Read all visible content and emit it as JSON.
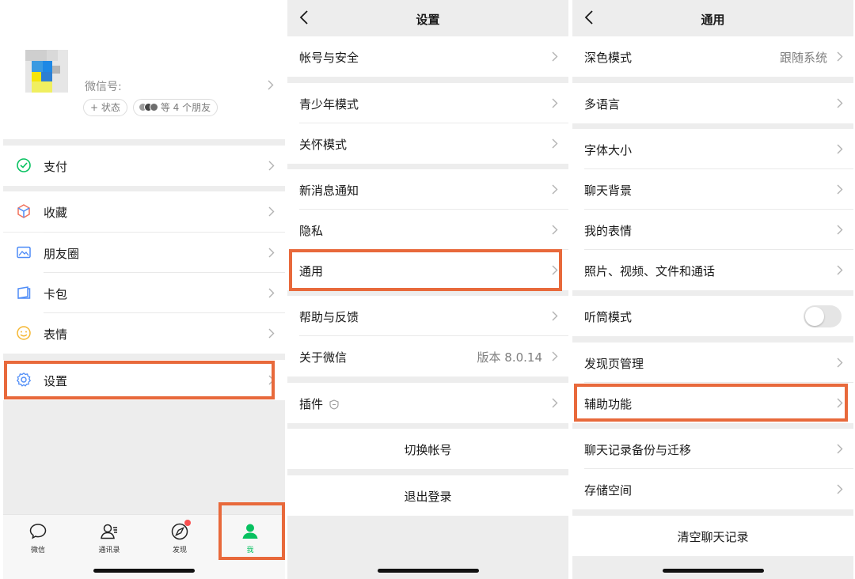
{
  "colors": {
    "accent_green": "#07c160",
    "highlight": "#e8693b",
    "badge_red": "#fa5151"
  },
  "me_screen": {
    "profile": {
      "wechat_id_label": "微信号:",
      "status_button": "+ 状态",
      "friends_text": "等 4 个朋友"
    },
    "menu": [
      {
        "label": "支付",
        "icon": "pay-icon"
      },
      {
        "label": "收藏",
        "icon": "favorites-icon"
      },
      {
        "label": "朋友圈",
        "icon": "moments-icon"
      },
      {
        "label": "卡包",
        "icon": "cards-icon"
      },
      {
        "label": "表情",
        "icon": "sticker-icon"
      },
      {
        "label": "设置",
        "icon": "settings-icon",
        "highlighted": true
      }
    ],
    "tabbar": [
      {
        "label": "微信",
        "icon": "chat-icon"
      },
      {
        "label": "通讯录",
        "icon": "contacts-icon"
      },
      {
        "label": "发现",
        "icon": "discover-icon",
        "badge": true
      },
      {
        "label": "我",
        "icon": "me-icon",
        "active": true,
        "highlighted": true
      }
    ]
  },
  "settings_screen": {
    "title": "设置",
    "items": [
      {
        "label": "帐号与安全"
      },
      {
        "label": "青少年模式"
      },
      {
        "label": "关怀模式"
      },
      {
        "label": "新消息通知"
      },
      {
        "label": "隐私"
      },
      {
        "label": "通用",
        "highlighted": true
      },
      {
        "label": "帮助与反馈"
      },
      {
        "label": "关于微信",
        "value": "版本 8.0.14"
      },
      {
        "label": "插件",
        "icon": "plugin-shield-icon"
      }
    ],
    "switch_account": "切换帐号",
    "logout": "退出登录"
  },
  "general_screen": {
    "title": "通用",
    "items": [
      {
        "label": "深色模式",
        "value": "跟随系统"
      },
      {
        "label": "多语言"
      },
      {
        "label": "字体大小"
      },
      {
        "label": "聊天背景"
      },
      {
        "label": "我的表情"
      },
      {
        "label": "照片、视频、文件和通话"
      },
      {
        "label": "听筒模式",
        "toggle": false
      },
      {
        "label": "发现页管理"
      },
      {
        "label": "辅助功能",
        "highlighted": true
      },
      {
        "label": "聊天记录备份与迁移"
      },
      {
        "label": "存储空间"
      }
    ],
    "clear_chat": "清空聊天记录"
  }
}
